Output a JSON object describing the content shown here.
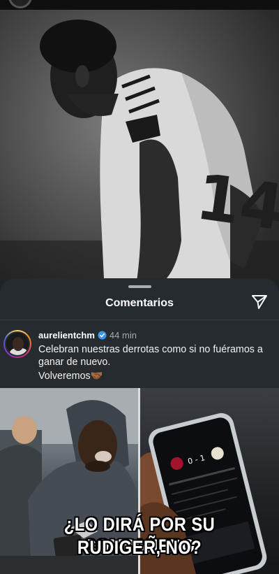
{
  "comments_sheet": {
    "title": "Comentarios"
  },
  "comment": {
    "username": "aurelientchm",
    "time": "44 min",
    "text": "Celebran nuestras derrotas como si no fuéramos a ganar de nuevo.",
    "text_second_line": "Volveremos🤝🏾"
  },
  "meme": {
    "caption_line1": "¿LO DIRÁ POR SU COMPAÑERO",
    "caption_line2": "RUDIGER, NO?",
    "scoreboard": "0 - 1"
  },
  "colors": {
    "sheet_background": "#262b30",
    "verified_badge": "#3897f0",
    "time_text": "#a5a9ad"
  }
}
